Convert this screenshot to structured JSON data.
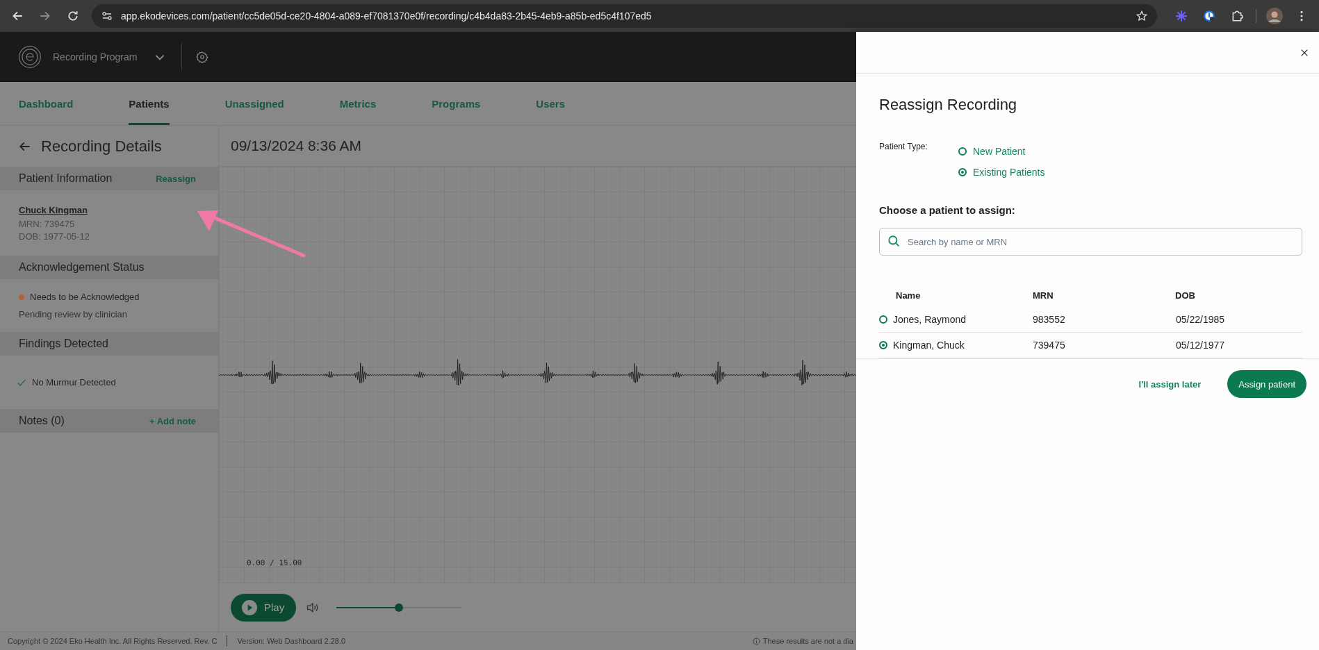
{
  "browser": {
    "url": "app.ekodevices.com/patient/cc5de05d-ce20-4804-a089-ef7081370e0f/recording/c4b4da83-2b45-4eb9-a85b-ed5c4f107ed5"
  },
  "header": {
    "program": "Recording Program"
  },
  "nav": [
    {
      "label": "Dashboard",
      "selected": false
    },
    {
      "label": "Patients",
      "selected": true
    },
    {
      "label": "Unassigned",
      "selected": false
    },
    {
      "label": "Metrics",
      "selected": false
    },
    {
      "label": "Programs",
      "selected": false
    },
    {
      "label": "Users",
      "selected": false
    }
  ],
  "details": {
    "title": "Recording Details",
    "patient": {
      "heading": "Patient Information",
      "action": "Reassign",
      "name": "Chuck Kingman",
      "mrn": "MRN: 739475",
      "dob": "DOB: 1977-05-12"
    },
    "acknowledgement": {
      "heading": "Acknowledgement Status",
      "status": "Needs to be Acknowledged",
      "color": "#b3623c",
      "note": "Pending review by clinician"
    },
    "findings": {
      "heading": "Findings Detected",
      "items": [
        "No Murmur Detected"
      ]
    },
    "notes": {
      "heading": "Notes (0)",
      "action": "+ Add note"
    }
  },
  "recording": {
    "timestamp": "09/13/2024 8:36 AM",
    "time": "0.00 / 15.00",
    "play": "Play",
    "volume": {
      "level": 0.5
    }
  },
  "footer": {
    "copyright": "Copyright © 2024 Eko Health Inc. All Rights Reserved. Rev. C",
    "version": "Version: Web Dashboard 2.28.0",
    "disclaimer": "These results are not a dia"
  },
  "drawer": {
    "title": "Reassign Recording",
    "patient_type_label": "Patient Type:",
    "patient_types": [
      {
        "label": "New Patient",
        "selected": false
      },
      {
        "label": "Existing Patients",
        "selected": true
      }
    ],
    "choose_label": "Choose a patient to assign:",
    "search": {
      "placeholder": "Search by name or MRN"
    },
    "columns": [
      "Name",
      "MRN",
      "DOB"
    ],
    "rows": [
      {
        "name": "Jones, Raymond",
        "mrn": "983552",
        "dob": "05/22/1985",
        "selected": false
      },
      {
        "name": "Kingman, Chuck",
        "mrn": "739475",
        "dob": "05/12/1977",
        "selected": true
      }
    ],
    "later": "I'll assign later",
    "assign": "Assign patient"
  }
}
